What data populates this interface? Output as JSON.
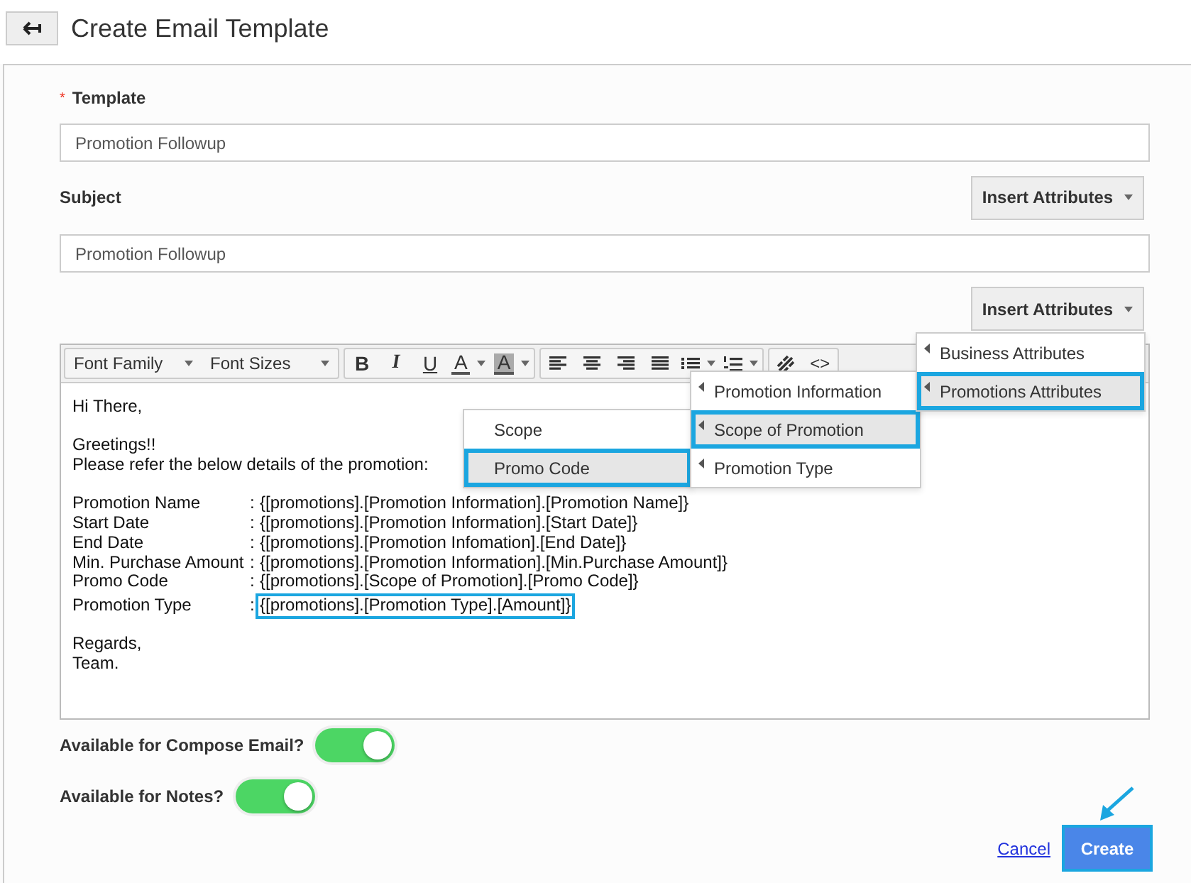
{
  "header": {
    "title": "Create Email Template"
  },
  "template": {
    "label": "Template",
    "required_mark": "*",
    "value": "Promotion Followup"
  },
  "subject": {
    "label": "Subject",
    "insert_button": "Insert Attributes",
    "value": "Promotion Followup"
  },
  "body_insert_button": "Insert Attributes",
  "toolbar": {
    "groups": [
      [
        {
          "kind": "select",
          "label": "Font Family"
        },
        {
          "kind": "select",
          "label": "Font Sizes"
        }
      ],
      [
        {
          "kind": "bold",
          "label": "B"
        },
        {
          "kind": "italic",
          "label": "I"
        },
        {
          "kind": "underline",
          "label": "U"
        },
        {
          "kind": "forecolor",
          "label": "A"
        },
        {
          "kind": "backcolor",
          "label": "A"
        }
      ],
      [
        {
          "kind": "align-left"
        },
        {
          "kind": "align-center"
        },
        {
          "kind": "align-right"
        },
        {
          "kind": "justify"
        },
        {
          "kind": "bullets"
        },
        {
          "kind": "numbers"
        }
      ],
      [
        {
          "kind": "link"
        },
        {
          "kind": "code",
          "label": "<>"
        }
      ]
    ]
  },
  "body": [
    {
      "kind": "text",
      "text": "Hi There,"
    },
    {
      "kind": "blank"
    },
    {
      "kind": "text",
      "text": "Greetings!!"
    },
    {
      "kind": "text",
      "text": "Please refer the below details of the promotion:"
    },
    {
      "kind": "blank"
    },
    {
      "kind": "field",
      "label": "Promotion Name",
      "separator": ":",
      "value": "{[promotions].[Promotion Information].[Promotion Name]}",
      "highlighted": false
    },
    {
      "kind": "field",
      "label": "Start Date",
      "separator": ":",
      "value": "{[promotions].[Promotion Information].[Start Date]}",
      "highlighted": false
    },
    {
      "kind": "field",
      "label": "End Date",
      "separator": ":",
      "value": "{[promotions].[Promotion Infomation].[End Date]}",
      "highlighted": false
    },
    {
      "kind": "field",
      "label": "Min. Purchase Amount",
      "separator": ":",
      "value": "{[promotions].[Promotion Information].[Min.Purchase Amount]}",
      "highlighted": false
    },
    {
      "kind": "field",
      "label": "Promo Code",
      "separator": ":",
      "value": "{[promotions].[Scope of Promotion].[Promo Code]}",
      "highlighted": false
    },
    {
      "kind": "field",
      "label": "Promotion Type",
      "separator": ":",
      "value": "{[promotions].[Promotion Type].[Amount]}",
      "highlighted": true
    },
    {
      "kind": "blank"
    },
    {
      "kind": "text",
      "text": "Regards,"
    },
    {
      "kind": "text",
      "text": "Team."
    }
  ],
  "menus": [
    {
      "items": [
        {
          "label": "Scope",
          "submenu": false,
          "selected": false
        },
        {
          "label": "Promo Code",
          "submenu": false,
          "selected": true
        }
      ]
    },
    {
      "items": [
        {
          "label": "Promotion Information",
          "submenu": true,
          "selected": false
        },
        {
          "label": "Scope of Promotion",
          "submenu": true,
          "selected": true
        },
        {
          "label": "Promotion Type",
          "submenu": true,
          "selected": false
        }
      ]
    },
    {
      "items": [
        {
          "label": "Business Attributes",
          "submenu": true,
          "selected": false
        },
        {
          "label": "Promotions Attributes",
          "submenu": true,
          "selected": true
        }
      ]
    }
  ],
  "toggles": [
    {
      "label": "Available for Compose Email?",
      "on": true
    },
    {
      "label": "Available for Notes?",
      "on": true
    }
  ],
  "actions": {
    "cancel": "Cancel",
    "create": "Create"
  }
}
